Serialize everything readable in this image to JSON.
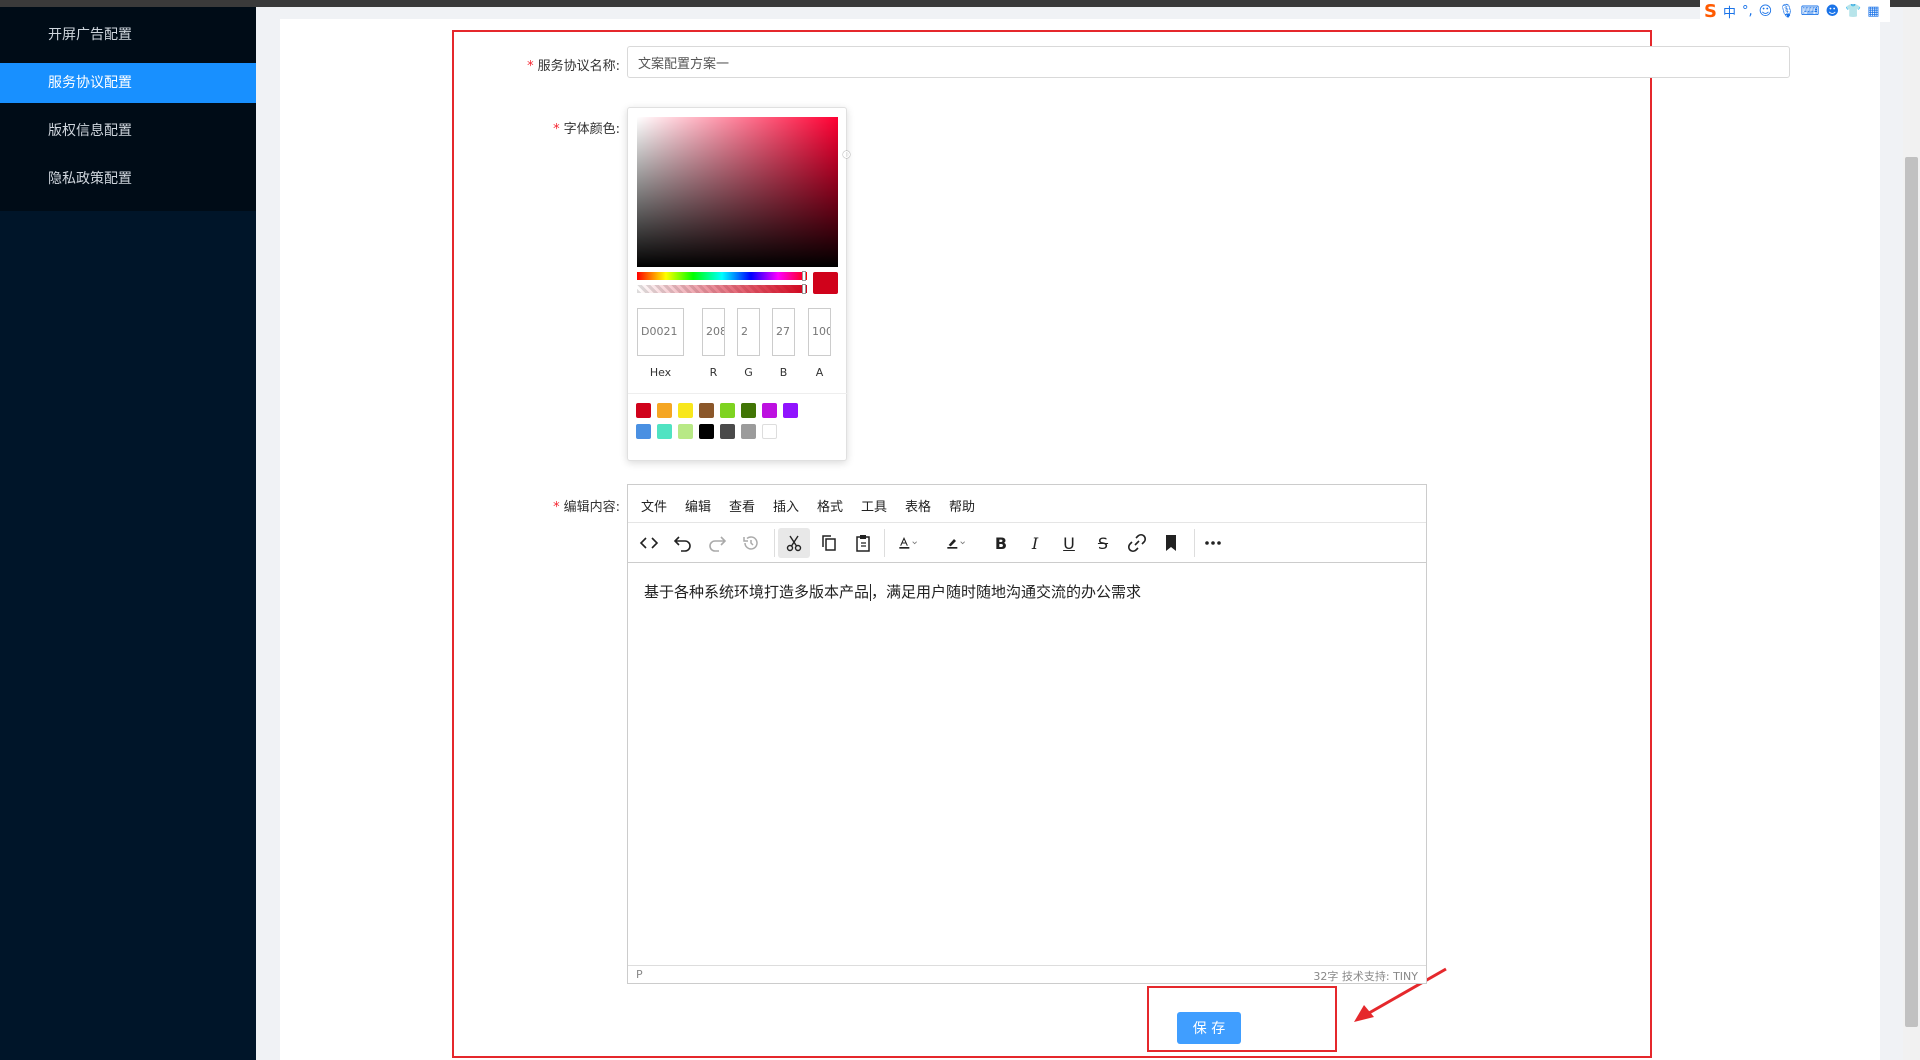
{
  "sidebar": {
    "items": [
      {
        "label": "开屏广告配置",
        "active": false
      },
      {
        "label": "服务协议配置",
        "active": true
      },
      {
        "label": "版权信息配置",
        "active": false
      },
      {
        "label": "隐私政策配置",
        "active": false
      }
    ]
  },
  "form": {
    "name_label": "服务协议名称:",
    "name_value": "文案配置方案一",
    "color_label": "字体颜色:",
    "content_label": "编辑内容:",
    "save_label": "保 存"
  },
  "color_picker": {
    "hex_value": "D0021",
    "r_value": "208",
    "g_value": "2",
    "b_value": "27",
    "a_value": "100",
    "labels": {
      "hex": "Hex",
      "r": "R",
      "g": "G",
      "b": "B",
      "a": "A"
    },
    "selected_color": "#d0021b",
    "swatches": [
      "#d0021b",
      "#f5a623",
      "#f8e71c",
      "#8b572a",
      "#7ed321",
      "#417505",
      "#bd10e0",
      "#9013fe",
      "#4a90e2",
      "#50e3c2",
      "#b8e986",
      "#000000",
      "#4a4a4a",
      "#9b9b9b",
      "#ffffff"
    ]
  },
  "editor": {
    "menus": [
      "文件",
      "编辑",
      "查看",
      "插入",
      "格式",
      "工具",
      "表格",
      "帮助"
    ],
    "content": "基于各种系统环境打造多版本产品",
    "content_after_caret": "，满足用户随时随地沟通交流的办公需求",
    "status_path": "P",
    "status_right": "32字  技术支持: TINY",
    "toolbar_icons": [
      "code-icon",
      "undo-icon",
      "redo-icon",
      "history-icon",
      "cut-icon",
      "copy-icon",
      "paste-icon",
      "text-color-icon",
      "highlight-color-icon",
      "bold-icon",
      "italic-icon",
      "underline-icon",
      "strikethrough-icon",
      "link-icon",
      "bookmark-icon",
      "more-icon"
    ]
  },
  "ime": {
    "logo": "S",
    "mode": "中"
  },
  "colors": {
    "sidebar_bg": "#001529",
    "active_item": "#1890ff",
    "primary_button": "#409eff",
    "annotation_red": "#e5282c"
  }
}
